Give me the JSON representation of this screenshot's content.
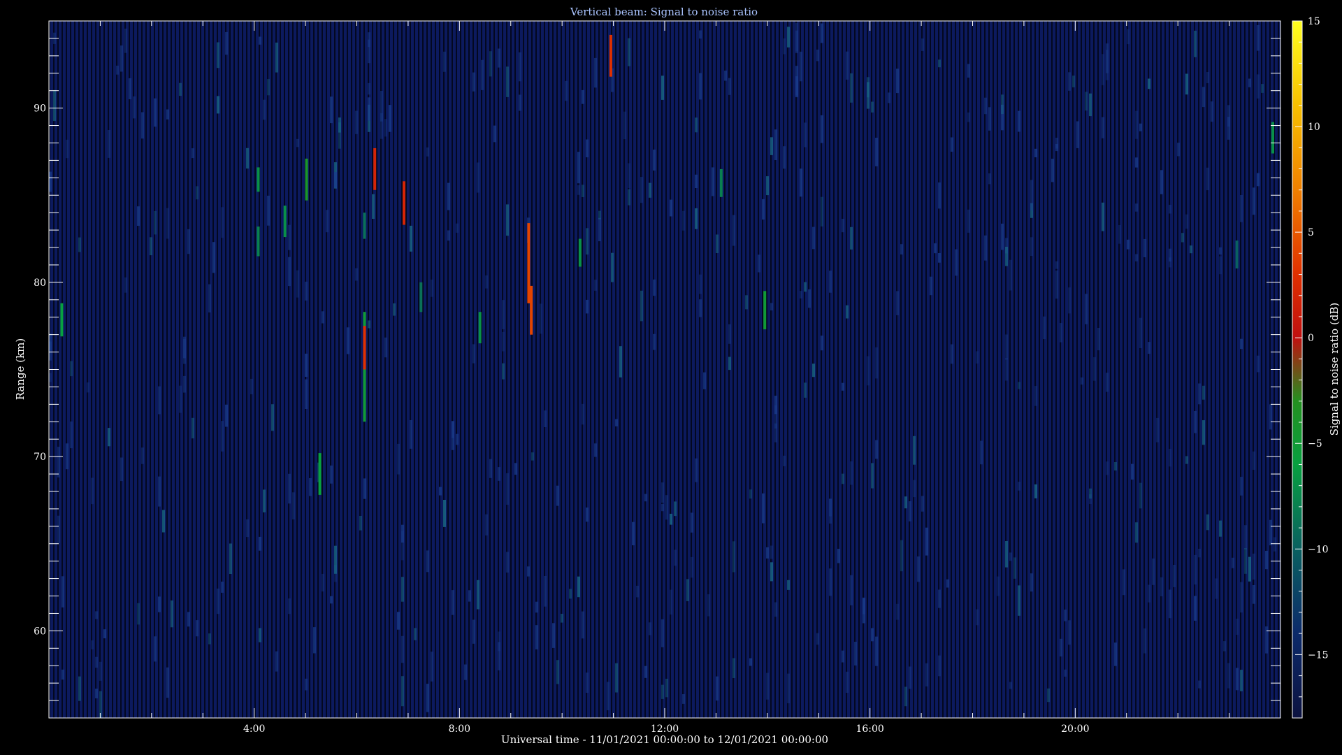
{
  "chart_data": {
    "type": "heatmap",
    "title": "Vertical beam: Signal to noise ratio",
    "xlabel": "Universal time - 11/01/2021 00:00:00 to 12/01/2021 00:00:00",
    "ylabel": "Range (km)",
    "colorbar_label": "Signal to noise ratio (dB)",
    "xlim": [
      0,
      24
    ],
    "ylim": [
      55,
      95
    ],
    "x_ticks": [
      4,
      8,
      12,
      16,
      20
    ],
    "x_tick_labels": [
      "4:00",
      "8:00",
      "12:00",
      "16:00",
      "20:00"
    ],
    "y_ticks": [
      60,
      70,
      80,
      90
    ],
    "y_tick_labels": [
      "60",
      "70",
      "80",
      "90"
    ],
    "colorbar_range": [
      -18,
      15
    ],
    "colorbar_ticks": [
      15,
      10,
      5,
      0,
      -5,
      -10,
      -15
    ],
    "colorbar_tick_labels": [
      "15",
      "10",
      "5",
      "0",
      "−5",
      "−10",
      "−15"
    ],
    "background_snr_db": -16,
    "grid": false,
    "detections": [
      {
        "time_h": 0.25,
        "range_km": [
          76.9,
          78.8
        ],
        "snr_db": -6
      },
      {
        "time_h": 4.08,
        "range_km": [
          85.2,
          86.6
        ],
        "snr_db": -7
      },
      {
        "time_h": 4.08,
        "range_km": [
          81.5,
          83.2
        ],
        "snr_db": -8
      },
      {
        "time_h": 4.6,
        "range_km": [
          82.6,
          84.4
        ],
        "snr_db": -7
      },
      {
        "time_h": 5.02,
        "range_km": [
          84.7,
          87.1
        ],
        "snr_db": -4
      },
      {
        "time_h": 5.28,
        "range_km": [
          67.8,
          70.2
        ],
        "snr_db": -6
      },
      {
        "time_h": 6.15,
        "range_km": [
          72,
          78.3
        ],
        "snr_db": -5
      },
      {
        "time_h": 6.15,
        "range_km": [
          75,
          77.5
        ],
        "snr_db": 3
      },
      {
        "time_h": 6.15,
        "range_km": [
          82.5,
          84
        ],
        "snr_db": -9
      },
      {
        "time_h": 6.35,
        "range_km": [
          85.3,
          87.7
        ],
        "snr_db": 2
      },
      {
        "time_h": 6.92,
        "range_km": [
          83.3,
          85.8
        ],
        "snr_db": 2
      },
      {
        "time_h": 7.25,
        "range_km": [
          78.3,
          80
        ],
        "snr_db": -9
      },
      {
        "time_h": 8.4,
        "range_km": [
          76.5,
          78.3
        ],
        "snr_db": -7
      },
      {
        "time_h": 9.35,
        "range_km": [
          78.8,
          83.4
        ],
        "snr_db": 4
      },
      {
        "time_h": 9.4,
        "range_km": [
          77,
          79.8
        ],
        "snr_db": 4
      },
      {
        "time_h": 10.35,
        "range_km": [
          80.9,
          82.5
        ],
        "snr_db": -7
      },
      {
        "time_h": 10.95,
        "range_km": [
          91.8,
          94.2
        ],
        "snr_db": 3
      },
      {
        "time_h": 13.1,
        "range_km": [
          84.9,
          86.5
        ],
        "snr_db": -8
      },
      {
        "time_h": 13.95,
        "range_km": [
          77.3,
          79.5
        ],
        "snr_db": -5
      },
      {
        "time_h": 23.85,
        "range_km": [
          87.4,
          89.2
        ],
        "snr_db": -7
      },
      {
        "time_h": 23.15,
        "range_km": [
          80.8,
          82.4
        ],
        "snr_db": -10
      }
    ]
  }
}
